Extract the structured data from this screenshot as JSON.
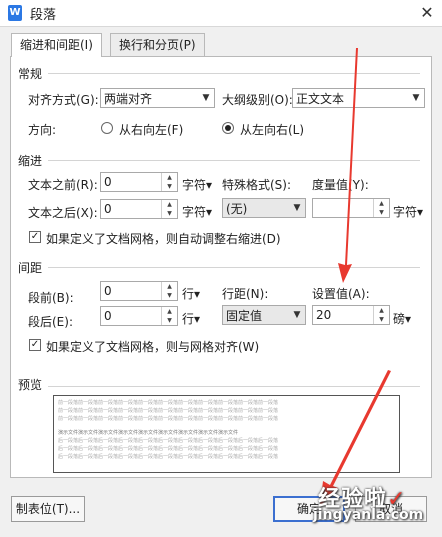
{
  "window": {
    "title": "段落",
    "app_icon": "W",
    "close_glyph": "✕"
  },
  "tabs": [
    {
      "label": "缩进和间距(I)"
    },
    {
      "label": "换行和分页(P)"
    }
  ],
  "general": {
    "section": "常规",
    "alignment_label": "对齐方式(G):",
    "alignment_value": "两端对齐",
    "outline_label": "大纲级别(O):",
    "outline_value": "正文文本",
    "direction_label": "方向:",
    "rtl_label": "从右向左(F)",
    "ltr_label": "从左向右(L)"
  },
  "indent": {
    "section": "缩进",
    "before_label": "文本之前(R):",
    "before_value": "0",
    "after_label": "文本之后(X):",
    "after_value": "0",
    "unit": "字符▾",
    "special_label": "特殊格式(S):",
    "special_value": "(无)",
    "measure_label": "度量值(Y):",
    "measure_value": "",
    "measure_unit": "字符▾",
    "auto_adjust_label": "如果定义了文档网格，则自动调整右缩进(D)"
  },
  "spacing": {
    "section": "间距",
    "before_label": "段前(B):",
    "before_value": "0",
    "after_label": "段后(E):",
    "after_value": "0",
    "unit": "行▾",
    "line_label": "行距(N):",
    "line_value": "固定值",
    "set_label": "设置值(A):",
    "set_value": "20",
    "set_unit": "磅▾",
    "snap_grid_label": "如果定义了文档网格，则与网格对齐(W)"
  },
  "preview": {
    "section": "预览",
    "prev_line": "前一段落前一段落前一段落前一段落前一段落前一段落前一段落前一段落前一段落前一段落前一段落",
    "sample_line": "演示文件演示文件演示文件演示文件演示文件演示文件演示文件演示文件演示文件",
    "next_line": "后一段落后一段落后一段落后一段落后一段落后一段落后一段落后一段落后一段落后一段落后一段落"
  },
  "buttons": {
    "tabs": "制表位(T)...",
    "ok": "确定",
    "cancel": "取消"
  },
  "watermark": {
    "brand": "经验啦",
    "check": "✓",
    "url": "jingyanla.com"
  },
  "colors": {
    "accent": "#3b6fd0",
    "annotation_arrow": "#e8392f"
  }
}
